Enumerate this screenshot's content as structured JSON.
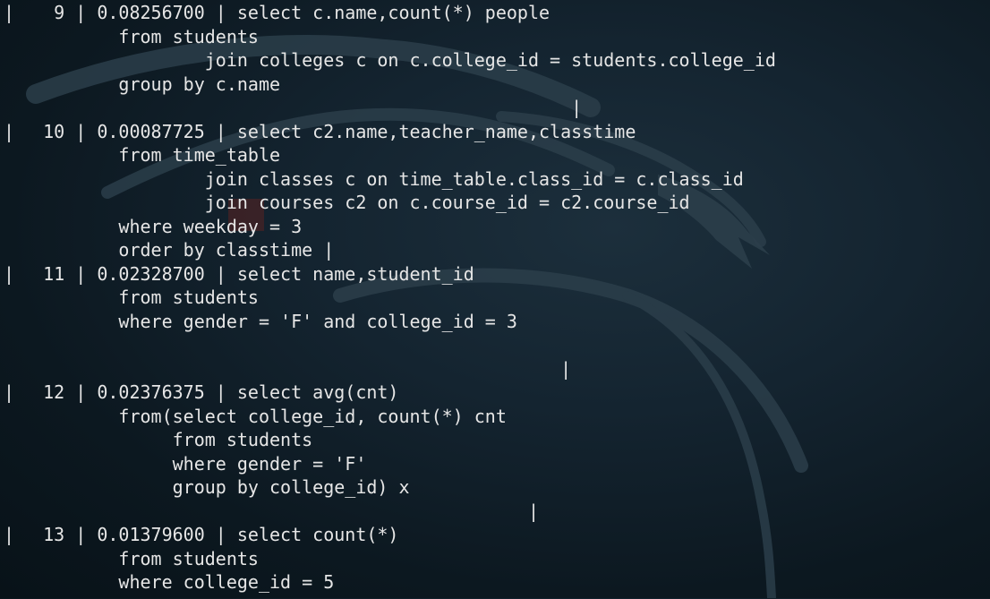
{
  "terminal": {
    "rows": [
      {
        "bar": "|",
        "text": "    9 | 0.08256700 | select c.name,count(*) people"
      },
      {
        "bar": "",
        "text": "          from students"
      },
      {
        "bar": "",
        "text": "                  join colleges c on c.college_id = students.college_id"
      },
      {
        "bar": "",
        "text": "          group by c.name"
      },
      {
        "bar": "",
        "text": "                                                    |"
      },
      {
        "bar": "|",
        "text": "   10 | 0.00087725 | select c2.name,teacher_name,classtime"
      },
      {
        "bar": "",
        "text": "          from time_table"
      },
      {
        "bar": "",
        "text": "                  join classes c on time_table.class_id = c.class_id"
      },
      {
        "bar": "",
        "text": "                  join courses c2 on c.course_id = c2.course_id"
      },
      {
        "bar": "",
        "text": "          where weekday = 3"
      },
      {
        "bar": "",
        "text": "          order by classtime |"
      },
      {
        "bar": "|",
        "text": "   11 | 0.02328700 | select name,student_id"
      },
      {
        "bar": "",
        "text": "          from students"
      },
      {
        "bar": "",
        "text": "          where gender = 'F' and college_id = 3"
      },
      {
        "bar": "",
        "text": ""
      },
      {
        "bar": "",
        "text": "                                                   |"
      },
      {
        "bar": "|",
        "text": "   12 | 0.02376375 | select avg(cnt)"
      },
      {
        "bar": "",
        "text": "          from(select college_id, count(*) cnt"
      },
      {
        "bar": "",
        "text": "               from students"
      },
      {
        "bar": "",
        "text": "               where gender = 'F'"
      },
      {
        "bar": "",
        "text": "               group by college_id) x"
      },
      {
        "bar": "",
        "text": "                                                |"
      },
      {
        "bar": "|",
        "text": "   13 | 0.01379600 | select count(*)"
      },
      {
        "bar": "",
        "text": "          from students"
      },
      {
        "bar": "",
        "text": "          where college_id = 5"
      }
    ]
  },
  "colors": {
    "background": "#0c1820",
    "text": "#e6e6e6",
    "watermark": "#2a3c48"
  }
}
